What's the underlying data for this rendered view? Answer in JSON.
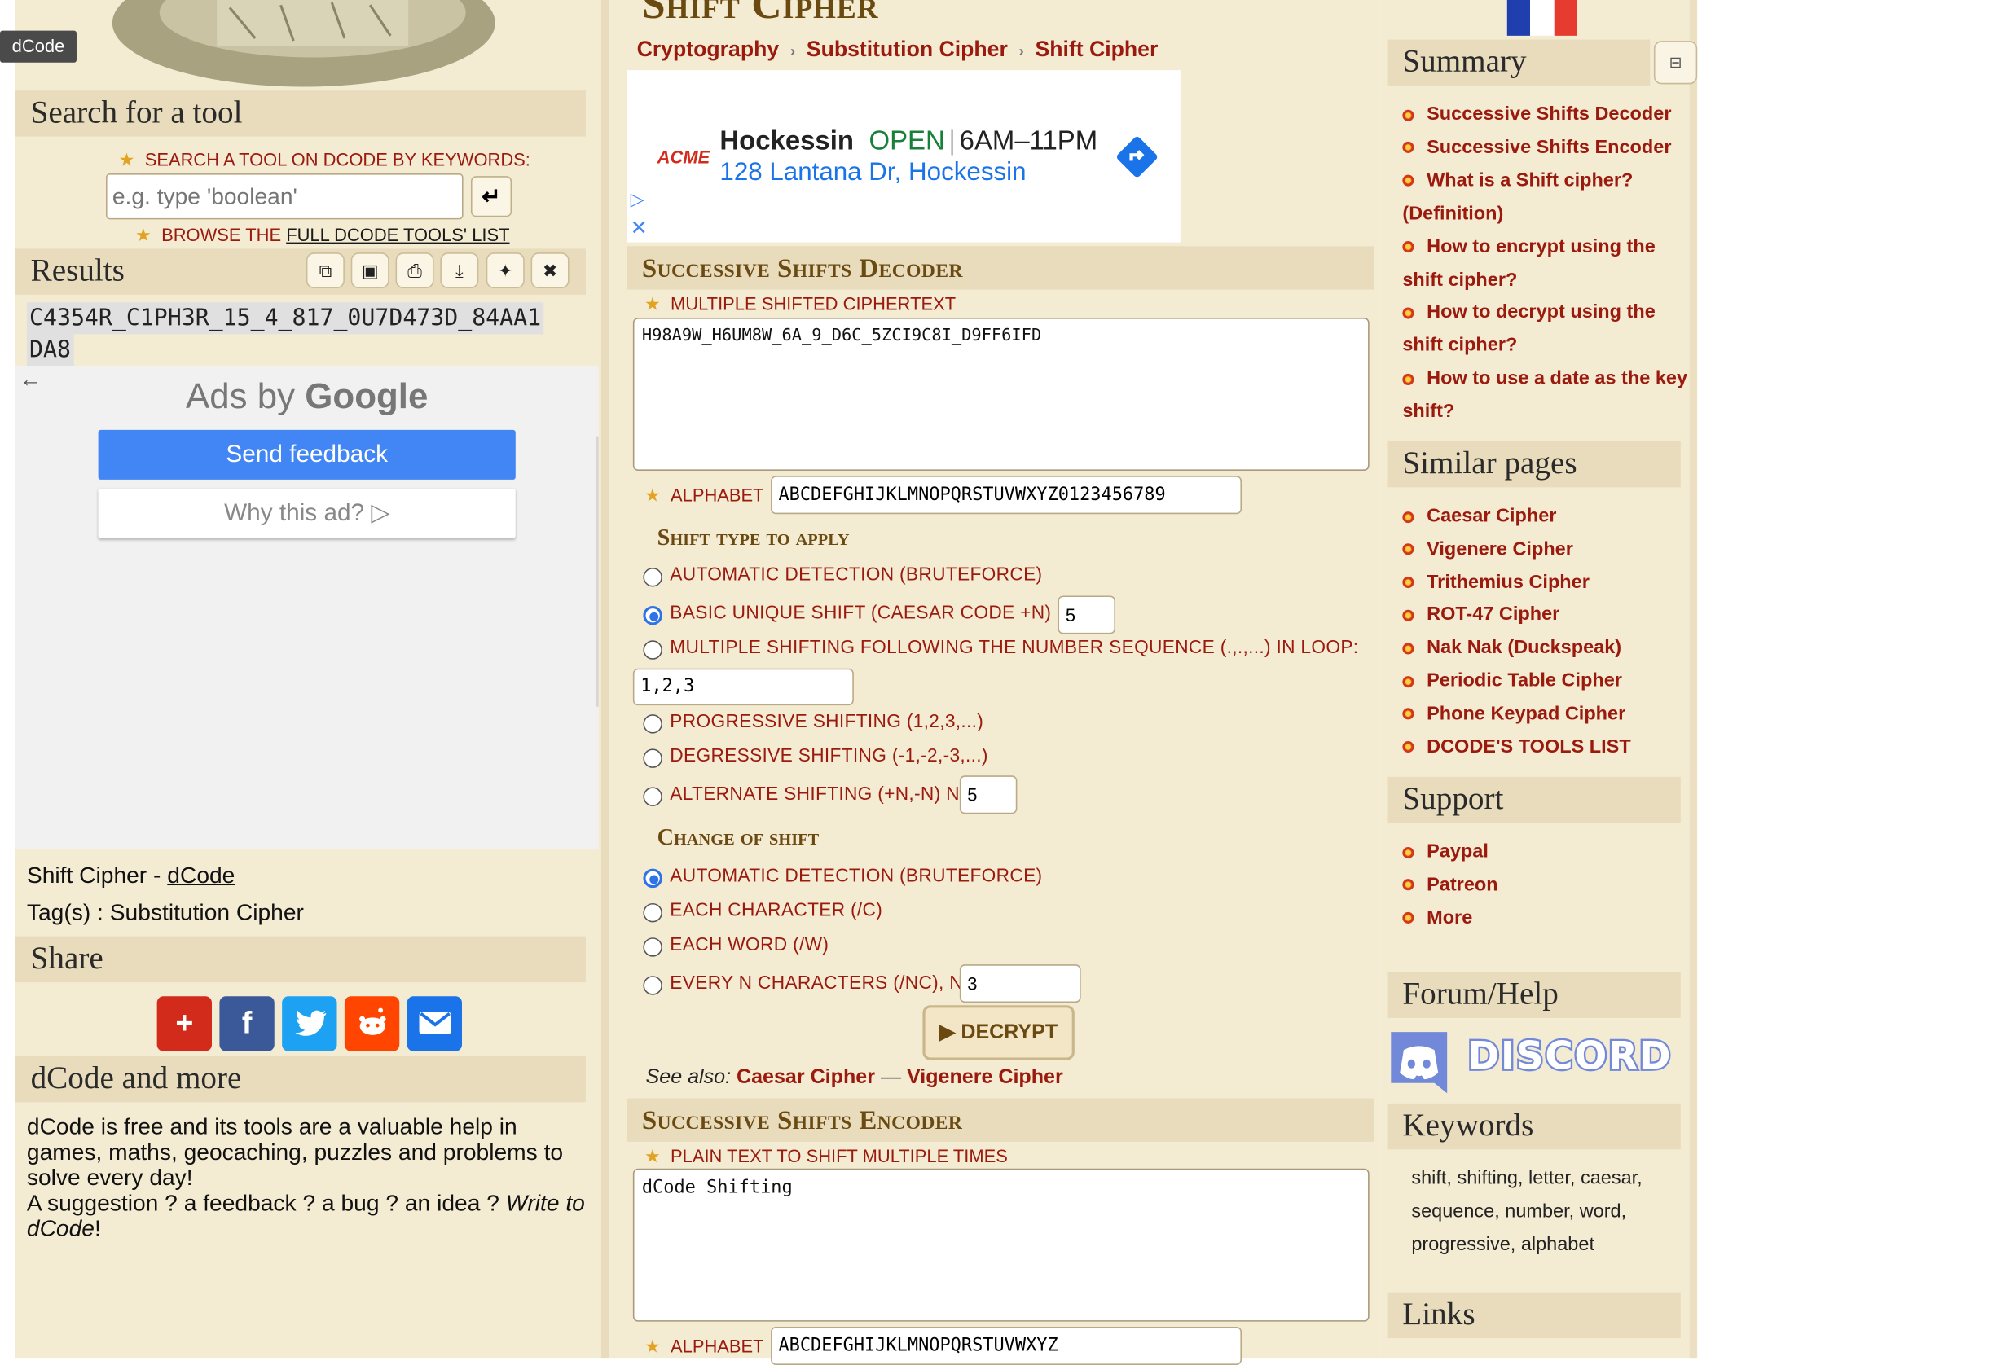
{
  "tooltip": "dCode",
  "left": {
    "search_title": "Search for a tool",
    "search_label": "SEARCH A TOOL ON DCODE BY KEYWORDS:",
    "search_placeholder": "e.g. type 'boolean'",
    "browse_prefix": "BROWSE THE",
    "browse_link": "FULL DCODE TOOLS' LIST",
    "results_title": "Results",
    "results_text_line1": "C4354R_C1PH3R_15_4_817_0U7D473D_84AA1",
    "results_text_line2": "DA8",
    "ads_by": "Ads by",
    "ads_google": "Google",
    "send_feedback": "Send feedback",
    "why_this_ad": "Why this ad?",
    "page_name": "Shift Cipher -",
    "page_link": "dCode",
    "tags": "Tag(s) : Substitution Cipher",
    "share_title": "Share",
    "more_title": "dCode and more",
    "more_text": "dCode is free and its tools are a valuable help in games, maths, geocaching, puzzles and problems to solve every day!",
    "suggestion": "A suggestion ? a feedback ? a bug ? an idea ?",
    "write_to": "Write to dCode",
    "excl": "!"
  },
  "mid": {
    "title": "Shift Cipher",
    "breadcrumb": [
      "Cryptography",
      "Substitution Cipher",
      "Shift Cipher"
    ],
    "ad": {
      "brand": "ACME",
      "name": "Hockessin",
      "status": "OPEN",
      "hours": "6AM–11PM",
      "address": "128 Lantana Dr, Hockessin"
    },
    "decoder": {
      "title": "Successive Shifts Decoder",
      "ciphertext_label": "MULTIPLE SHIFTED CIPHERTEXT",
      "ciphertext": "H98A9W_H6UM8W_6A_9_D6C_5ZCI9C8I_D9FF6IFD",
      "alphabet_label": "ALPHABET",
      "alphabet": "ABCDEFGHIJKLMNOPQRSTUVWXYZ0123456789",
      "shift_type_title": "Shift type to apply",
      "opt_auto": "AUTOMATIC DETECTION (BRUTEFORCE)",
      "opt_basic": "BASIC UNIQUE SHIFT (CAESAR CODE +N) OF:",
      "basic_value": "5",
      "opt_multiple": "MULTIPLE SHIFTING FOLLOWING THE NUMBER SEQUENCE (.,.,...) IN LOOP:",
      "sequence_value": "1,2,3",
      "opt_progressive": "PROGRESSIVE SHIFTING (1,2,3,...)",
      "opt_degressive": "DEGRESSIVE SHIFTING (-1,-2,-3,...)",
      "opt_alternate": "ALTERNATE SHIFTING (+N,-N) N=",
      "alternate_value": "5",
      "change_title": "Change of shift",
      "chg_auto": "AUTOMATIC DETECTION (BRUTEFORCE)",
      "chg_char": "EACH CHARACTER (/C)",
      "chg_word": "EACH WORD (/W)",
      "chg_n": "EVERY N CHARACTERS (/NC), N=",
      "n_value": "3",
      "decrypt": "DECRYPT",
      "see_also": "See also:",
      "see_caesar": "Caesar Cipher",
      "see_dash": "—",
      "see_vigenere": "Vigenere Cipher"
    },
    "encoder": {
      "title": "Successive Shifts Encoder",
      "plaintext_label": "PLAIN TEXT TO SHIFT MULTIPLE TIMES",
      "plaintext": "dCode Shifting",
      "alphabet_label": "ALPHABET",
      "alphabet": "ABCDEFGHIJKLMNOPQRSTUVWXYZ"
    }
  },
  "right": {
    "summary_title": "Summary",
    "summary": [
      "Successive Shifts Decoder",
      "Successive Shifts Encoder",
      "What is a Shift cipher?",
      "(Definition)",
      "How to encrypt using the",
      "shift cipher?",
      "How to decrypt using the",
      "shift cipher?",
      "How to use a date as the key",
      "shift?"
    ],
    "similar_title": "Similar pages",
    "similar": [
      "Caesar Cipher",
      "Vigenere Cipher",
      "Trithemius Cipher",
      "ROT-47 Cipher",
      "Nak Nak (Duckspeak)",
      "Periodic Table Cipher",
      "Phone Keypad Cipher",
      "DCODE'S TOOLS LIST"
    ],
    "support_title": "Support",
    "support": [
      "Paypal",
      "Patreon",
      "More"
    ],
    "forum_title": "Forum/Help",
    "discord": "DISCORD",
    "keywords_title": "Keywords",
    "keywords_line1": "shift, shifting, letter, caesar,",
    "keywords_line2": "sequence, number, word,",
    "keywords_line3": "progressive, alphabet",
    "links_title": "Links"
  },
  "colors": {
    "accent_red": "#9b1a0e",
    "header_bg": "#e8dcbd",
    "panel_bg": "#f4ebd3",
    "google_blue": "#4285f4"
  }
}
